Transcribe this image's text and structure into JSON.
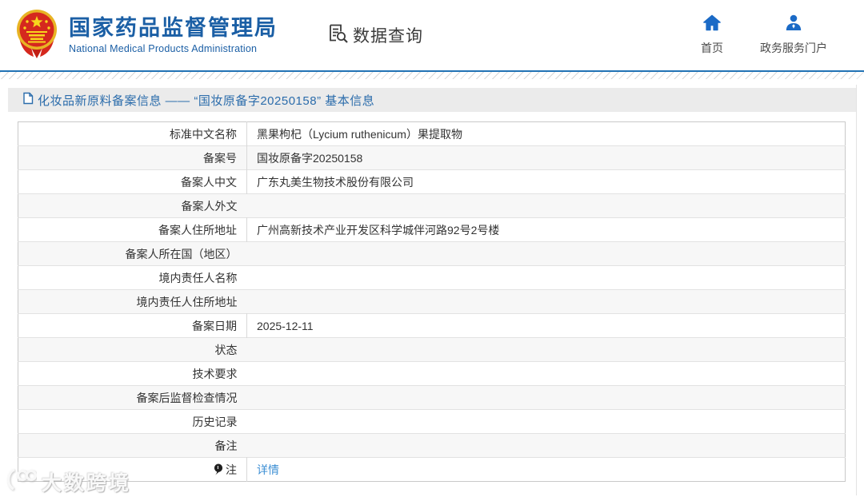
{
  "header": {
    "logo": {
      "emblem_icon": "china-national-emblem",
      "title_cn": "国家药品监督管理局",
      "title_en": "National Medical Products Administration"
    },
    "data_query": {
      "icon": "document-search-icon",
      "label": "数据查询"
    },
    "nav": [
      {
        "icon": "home-icon",
        "label": "首页"
      },
      {
        "icon": "user-icon",
        "label": "政务服务门户"
      }
    ]
  },
  "colors": {
    "accent_line": "#2273b5",
    "brand_blue": "#1b5fa5",
    "icon_blue": "#1b6ac6",
    "link_blue": "#3d8fd4",
    "title_bar_bg": "#ebebeb"
  },
  "breadcrumb": {
    "icon": "document-icon",
    "title": "化妆品新原料备案信息 —— “国妆原备字20250158” 基本信息"
  },
  "table": {
    "rows": [
      {
        "label": "标准中文名称",
        "value": "黑果枸杞（Lycium ruthenicum）果提取物"
      },
      {
        "label": "备案号",
        "value": "国妆原备字20250158"
      },
      {
        "label": "备案人中文",
        "value": "广东丸美生物技术股份有限公司"
      },
      {
        "label": "备案人外文",
        "value": ""
      },
      {
        "label": "备案人住所地址",
        "value": "广州高新技术产业开发区科学城伴河路92号2号楼"
      },
      {
        "label": "备案人所在国（地区）",
        "value": ""
      },
      {
        "label": "境内责任人名称",
        "value": ""
      },
      {
        "label": "境内责任人住所地址",
        "value": ""
      },
      {
        "label": "备案日期",
        "value": "2025-12-11"
      },
      {
        "label": "状态",
        "value": ""
      },
      {
        "label": "技术要求",
        "value": ""
      },
      {
        "label": "备案后监督检查情况",
        "value": ""
      },
      {
        "label": "历史记录",
        "value": ""
      },
      {
        "label": "备注",
        "value": ""
      },
      {
        "label": "注",
        "label_icon": "note-balloon-icon",
        "value": "详情",
        "value_is_link": true
      }
    ]
  },
  "watermark": {
    "logo_icon": "dashukuajing-logo",
    "text": "大数跨境"
  }
}
